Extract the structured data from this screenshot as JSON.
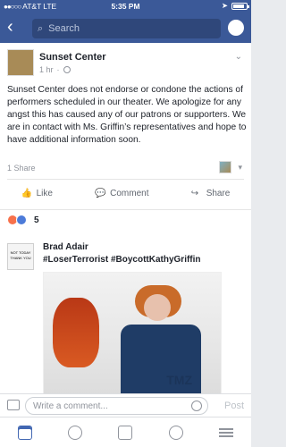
{
  "status_bar": {
    "carrier": "AT&T",
    "network": "LTE",
    "time": "5:35 PM"
  },
  "nav": {
    "search_placeholder": "Search"
  },
  "post": {
    "page_name": "Sunset Center",
    "time": "1 hr",
    "text": "Sunset Center does not endorse or condone the actions of performers scheduled in our theater. We apologize for any angst this has caused any of our patrons or supporters. We are in contact with Ms. Griffin’s representatives and hope to have additional information soon.",
    "shares": "1 Share",
    "actions": {
      "like": "Like",
      "comment": "Comment",
      "share": "Share"
    },
    "reaction_count": "5"
  },
  "comment": {
    "author": "Brad Adair",
    "text": "#LoserTerrorist #BoycottKathyGriffin",
    "avatar_text": "NOT TODAY THANK YOU",
    "watermark": "TMZ"
  },
  "composer": {
    "placeholder": "Write a comment...",
    "post_label": "Post"
  },
  "colors": {
    "brand": "#3b5998",
    "accent": "#4267b2"
  }
}
